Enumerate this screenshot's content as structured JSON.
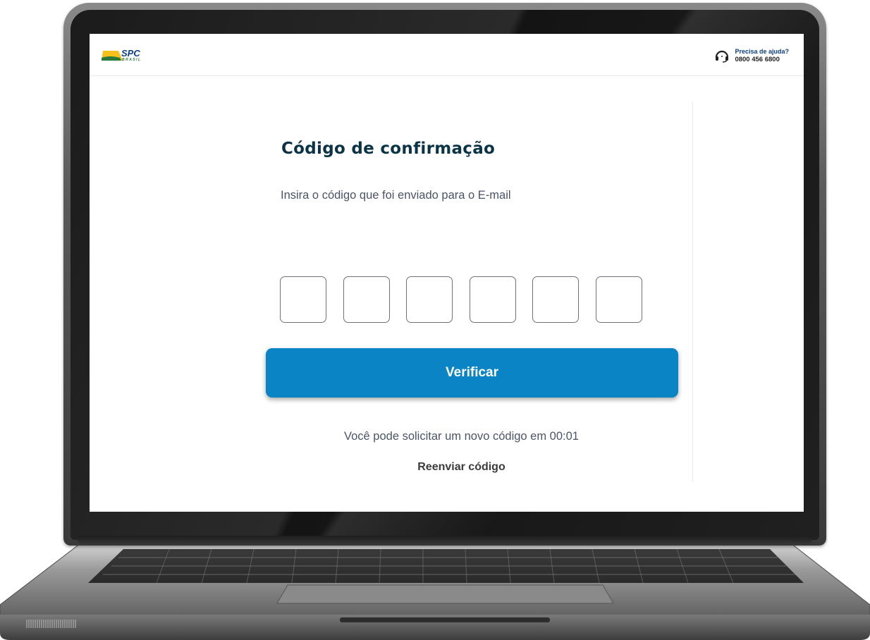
{
  "header": {
    "logo_text": "SPC",
    "logo_sub": "BRASIL",
    "help_title": "Precisa de ajuda?",
    "help_phone": "0800 456 6800"
  },
  "main": {
    "title": "Código de confirmação",
    "subtitle": "Insira o código que foi enviado para o E-mail",
    "code_boxes": [
      "",
      "",
      "",
      "",
      "",
      ""
    ],
    "verify_label": "Verificar",
    "timer_text": "Você pode solicitar um novo código em 00:01",
    "resend_label": "Reenviar código"
  },
  "colors": {
    "primary": "#0a84c5",
    "title": "#0a3346",
    "logo_blue": "#0d3f86",
    "logo_yellow": "#f4c21b"
  },
  "icons": {
    "help": "headset-icon",
    "logo": "spc-logo"
  }
}
